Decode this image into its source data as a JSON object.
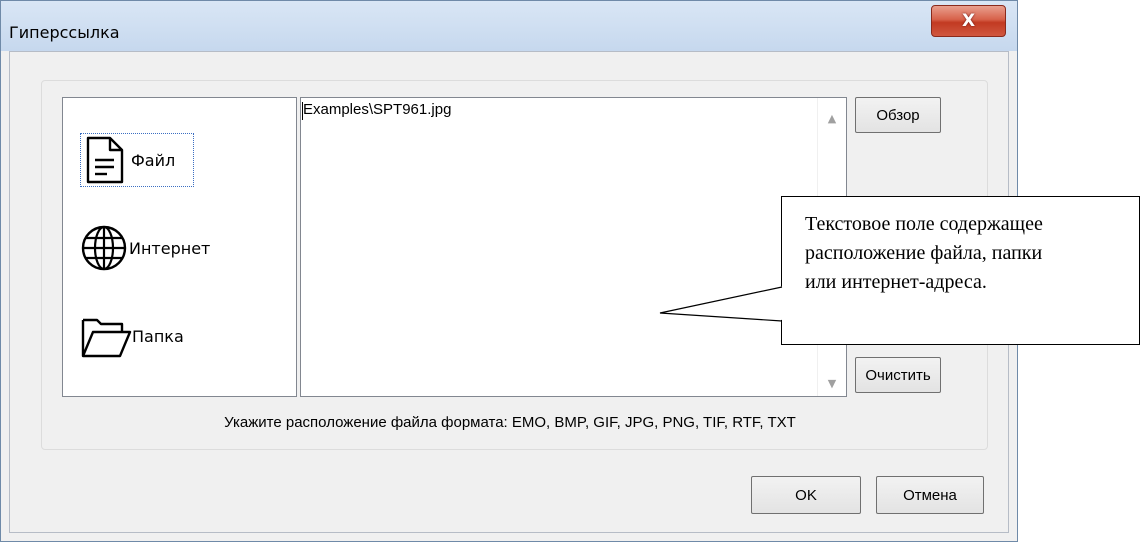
{
  "window": {
    "title": "Гиперссылка",
    "close_glyph": "X"
  },
  "link_types": [
    {
      "label": "Файл",
      "icon": "file-icon",
      "selected": true
    },
    {
      "label": "Интернет",
      "icon": "globe-icon",
      "selected": false
    },
    {
      "label": "Папка",
      "icon": "folder-icon",
      "selected": false
    }
  ],
  "path_field": {
    "value": "Examples\\SPT961.jpg"
  },
  "buttons": {
    "browse": "Обзор",
    "clear": "Очистить",
    "ok": "OK",
    "cancel": "Отмена"
  },
  "hint": "Укажите расположение файла формата: EMO, BMP, GIF, JPG, PNG, TIF, RTF, TXT",
  "callout": {
    "line1": "Текстовое поле содержащее",
    "line2": "расположение файла, папки",
    "line3": "или интернет-адреса."
  }
}
